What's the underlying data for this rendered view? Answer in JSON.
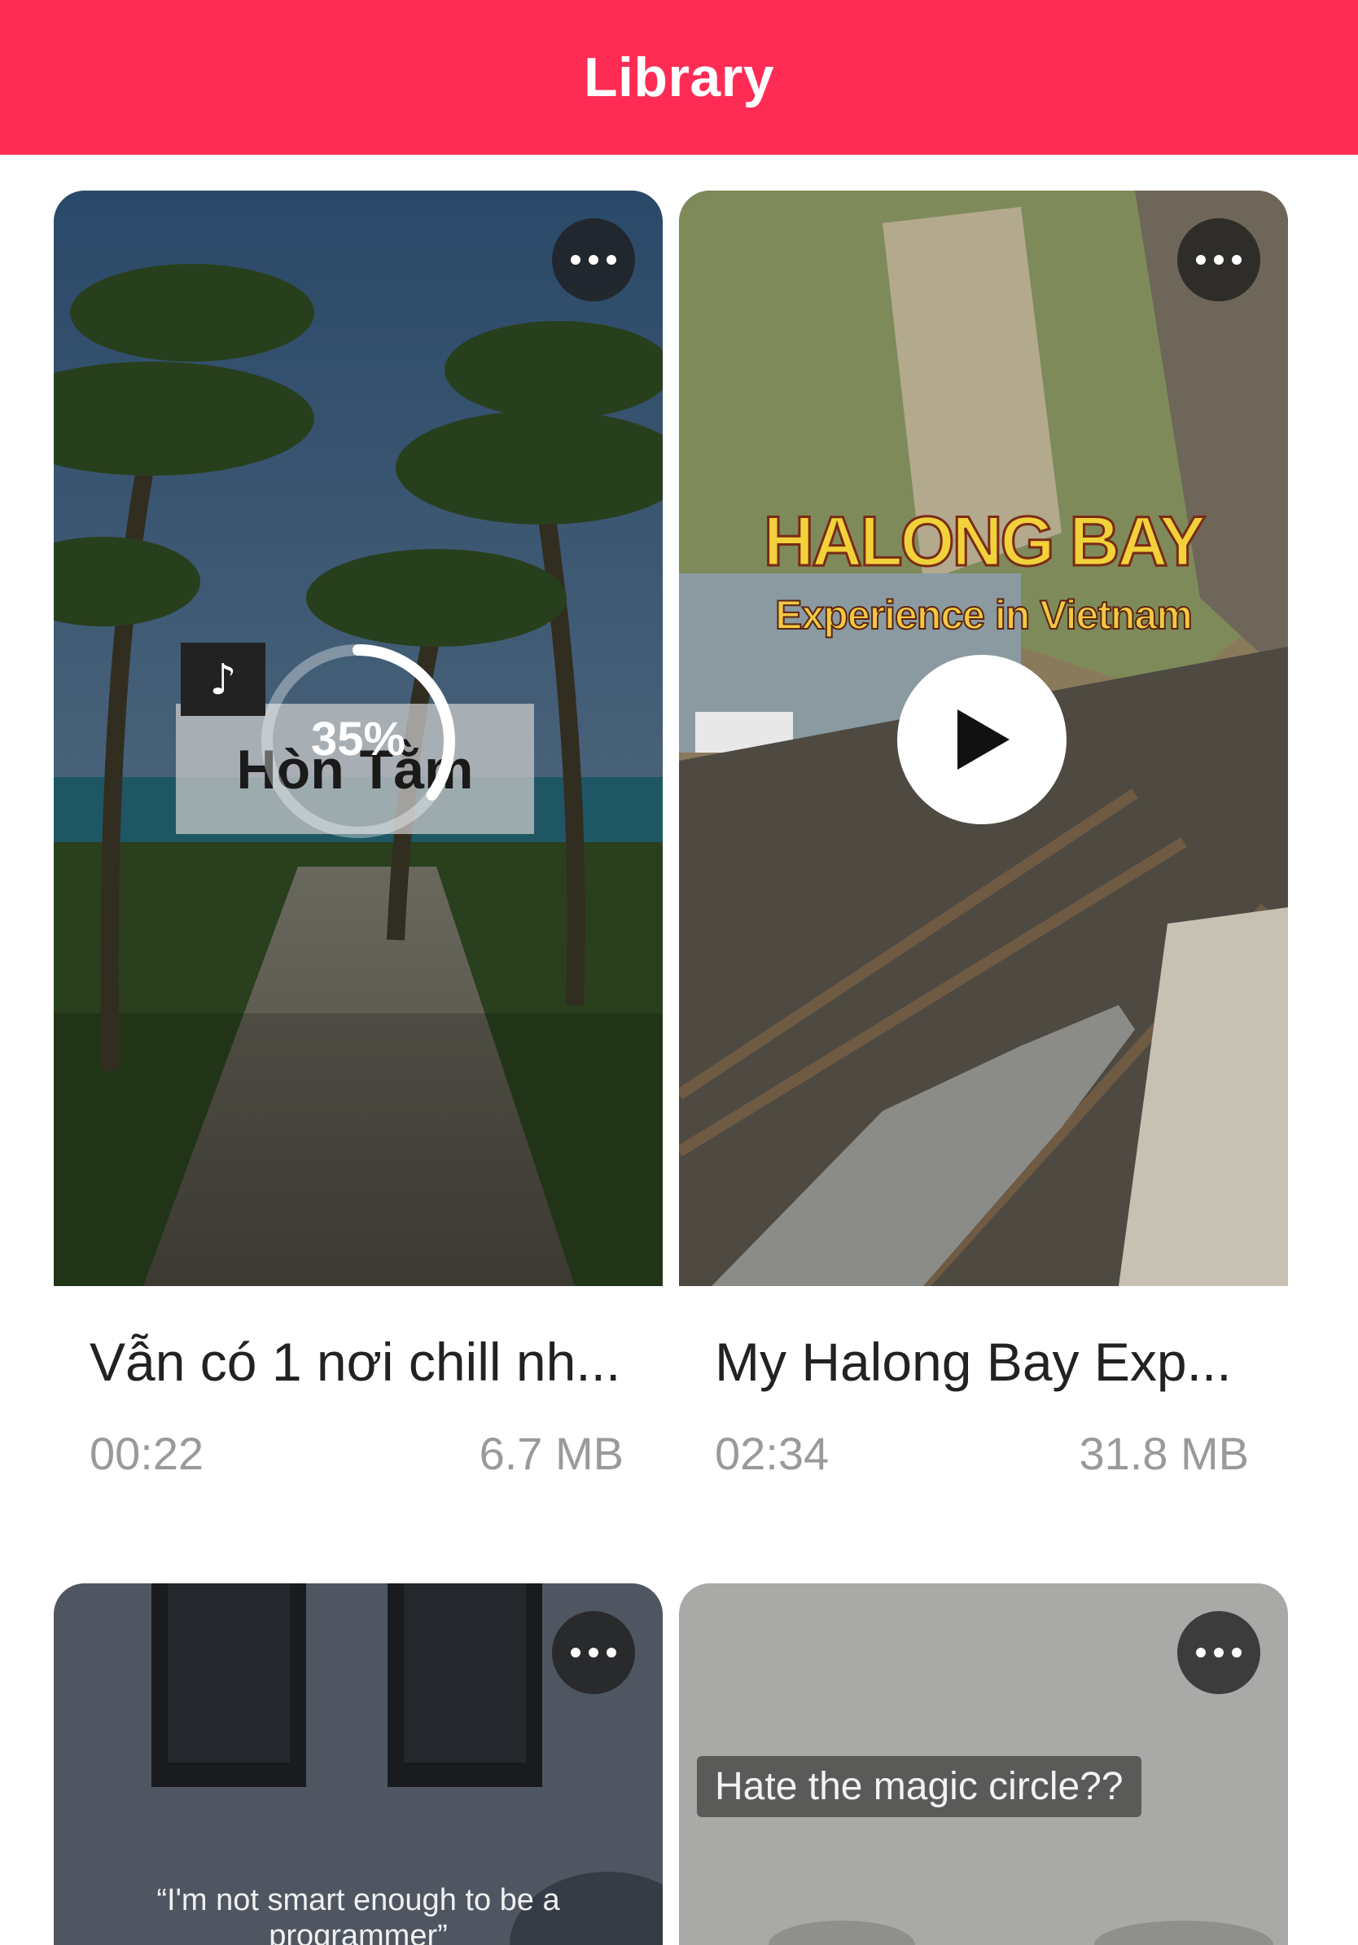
{
  "header": {
    "title": "Library"
  },
  "videos": [
    {
      "title": "Vẫn có 1 nơi chill nh...",
      "duration": "00:22",
      "size": "6.7 MB",
      "progress_label": "35%",
      "progress": 0.35,
      "overlay_text": "Hòn Tằm"
    },
    {
      "title": "My Halong Bay Exp...",
      "duration": "02:34",
      "size": "31.8 MB",
      "overlay_title": "HALONG BAY",
      "overlay_subtitle": "Experience in Vietnam"
    },
    {
      "overlay_caption_line1": "“I'm not smart enough to be a",
      "overlay_caption_line2": "programmer”"
    },
    {
      "overlay_caption": "Hate the magic circle??"
    }
  ],
  "colors": {
    "header_bg": "#fe2c55",
    "meta_text": "#9a9a9a",
    "title_text": "#222222"
  },
  "icons": {
    "more": "more-horizontal-icon",
    "play": "play-icon",
    "tiktok": "tiktok-icon"
  }
}
